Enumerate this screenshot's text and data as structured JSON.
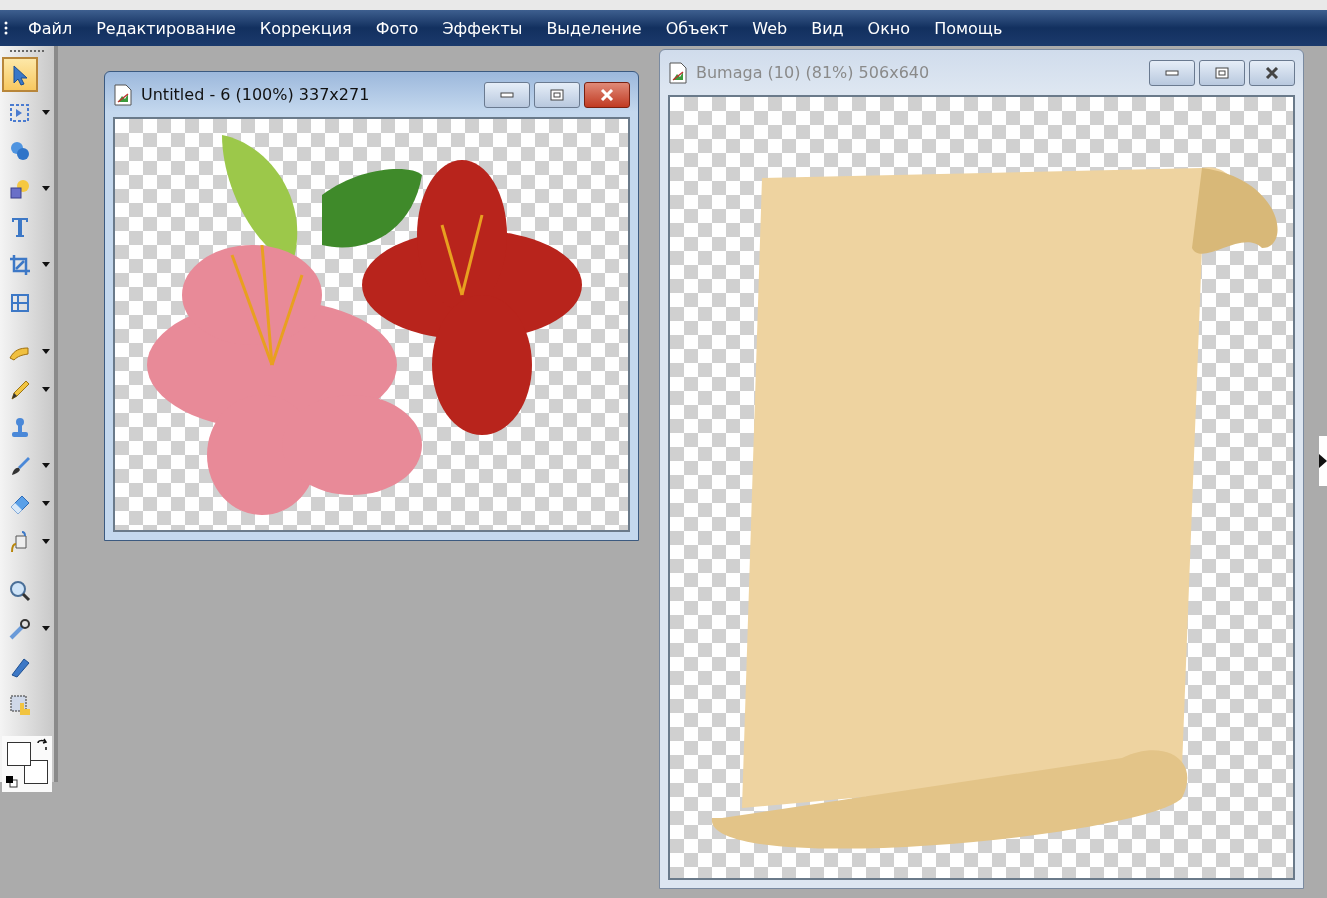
{
  "menu": [
    "Файл",
    "Редактирование",
    "Коррекция",
    "Фото",
    "Эффекты",
    "Выделение",
    "Объект",
    "Web",
    "Вид",
    "Окно",
    "Помощь"
  ],
  "toolbar": {
    "groups": [
      [
        {
          "kind": "pick",
          "selected": true,
          "dropdown": false
        },
        {
          "kind": "marquee",
          "selected": false,
          "dropdown": true
        },
        {
          "kind": "shapes",
          "selected": false,
          "dropdown": false
        },
        {
          "kind": "path",
          "selected": false,
          "dropdown": true
        },
        {
          "kind": "text",
          "selected": false,
          "dropdown": false
        },
        {
          "kind": "crop",
          "selected": false,
          "dropdown": true
        },
        {
          "kind": "transform",
          "selected": false,
          "dropdown": false
        }
      ],
      [
        {
          "kind": "paint",
          "selected": false,
          "dropdown": true
        },
        {
          "kind": "pencil",
          "selected": false,
          "dropdown": true
        },
        {
          "kind": "stamp",
          "selected": false,
          "dropdown": false
        },
        {
          "kind": "brush",
          "selected": false,
          "dropdown": true
        },
        {
          "kind": "eraser",
          "selected": false,
          "dropdown": true
        },
        {
          "kind": "fill",
          "selected": false,
          "dropdown": true
        }
      ],
      [
        {
          "kind": "zoom",
          "selected": false,
          "dropdown": false
        },
        {
          "kind": "eyedropper",
          "selected": false,
          "dropdown": true
        },
        {
          "kind": "marker",
          "selected": false,
          "dropdown": false
        },
        {
          "kind": "object",
          "selected": false,
          "dropdown": false
        }
      ]
    ]
  },
  "windows": [
    {
      "title": "Untitled - 6 (100%) 337x271",
      "active": true,
      "kind": "flowers"
    },
    {
      "title": "Bumaga (10) (81%) 506x640",
      "active": false,
      "kind": "scroll"
    }
  ]
}
